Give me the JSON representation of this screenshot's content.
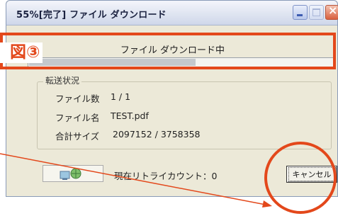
{
  "window": {
    "title": "55%[完了] ファイル ダウンロード",
    "status": "ファイル ダウンロード中",
    "progress": 0.55
  },
  "transfer": {
    "group_label": "転送状況",
    "file_count_label": "ファイル数",
    "file_count_value": "1 / 1",
    "file_name_label": "ファイル名",
    "file_name_value": "TEST.pdf",
    "total_size_label": "合計サイズ",
    "total_size_value": "2097152 / 3758358"
  },
  "footer": {
    "retry_text": "現在リトライカウント：0",
    "cancel_label": "キャンセル"
  },
  "annotation": {
    "label": "図③",
    "color": "#e3481b"
  }
}
